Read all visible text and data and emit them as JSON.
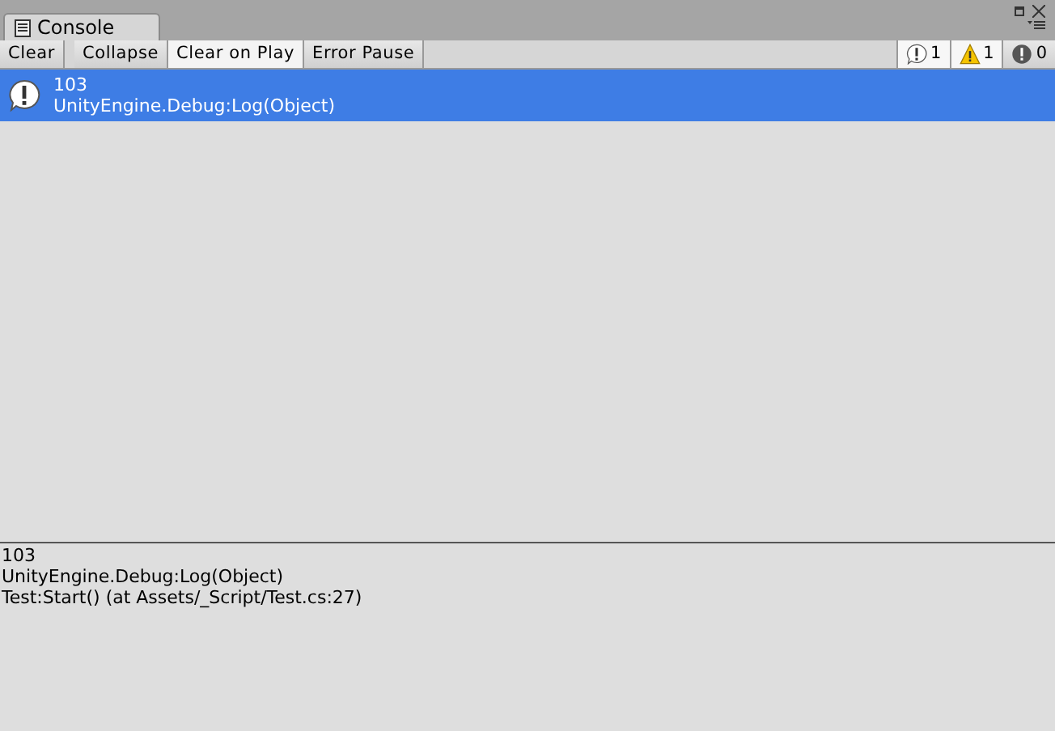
{
  "tab": {
    "title": "Console"
  },
  "toolbar": {
    "buttons": [
      {
        "label": "Clear",
        "kind": "button"
      },
      {
        "label": "Collapse",
        "kind": "toggle",
        "on": false
      },
      {
        "label": "Clear on Play",
        "kind": "toggle",
        "on": true
      },
      {
        "label": "Error Pause",
        "kind": "toggle",
        "on": false
      }
    ],
    "counters": [
      {
        "kind": "info",
        "count": "1",
        "on": true
      },
      {
        "kind": "warning",
        "count": "1",
        "on": true
      },
      {
        "kind": "error",
        "count": "0",
        "on": false
      }
    ]
  },
  "log": [
    {
      "kind": "info",
      "selected": true,
      "lines": [
        "103",
        "UnityEngine.Debug:Log(Object)"
      ]
    }
  ],
  "detail": {
    "lines": [
      "103",
      "UnityEngine.Debug:Log(Object)",
      "Test:Start() (at Assets/_Script/Test.cs:27)"
    ]
  }
}
